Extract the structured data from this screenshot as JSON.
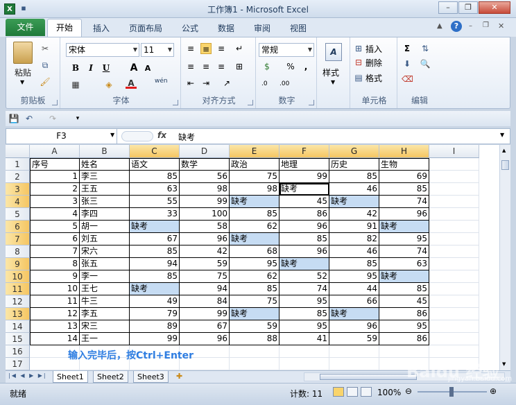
{
  "window": {
    "title": "工作簿1 - Microsoft Excel",
    "app_icon": "X"
  },
  "tabs": {
    "file": "文件",
    "home": "开始",
    "insert": "插入",
    "layout": "页面布局",
    "formula": "公式",
    "data": "数据",
    "review": "审阅",
    "view": "视图"
  },
  "ribbon": {
    "clipboard": {
      "label": "剪贴板",
      "paste": "粘贴"
    },
    "font": {
      "label": "字体",
      "name": "宋体",
      "size": "11",
      "bold": "B",
      "italic": "I",
      "underline": "U",
      "grow": "A",
      "shrink": "A",
      "border": "▦",
      "fill": "◈",
      "color": "A",
      "wen": "wén"
    },
    "alignment": {
      "label": "对齐方式"
    },
    "number": {
      "label": "数字",
      "format": "常规",
      "percent": "%",
      "comma": ","
    },
    "styles": {
      "label": "样式"
    },
    "cells": {
      "label": "单元格",
      "insert": "插入",
      "delete": "删除",
      "format": "格式"
    },
    "editing": {
      "label": "编辑"
    }
  },
  "formula_bar": {
    "name_box": "F3",
    "fx": "fx",
    "value": "缺考"
  },
  "columns": [
    "A",
    "B",
    "C",
    "D",
    "E",
    "F",
    "G",
    "H",
    "I"
  ],
  "rows": [
    [
      "序号",
      "姓名",
      "语文",
      "数学",
      "政治",
      "地理",
      "历史",
      "生物"
    ],
    [
      "1",
      "李三",
      "85",
      "56",
      "75",
      "99",
      "85",
      "69"
    ],
    [
      "2",
      "王五",
      "63",
      "98",
      "98",
      "缺考",
      "46",
      "85"
    ],
    [
      "3",
      "张三",
      "55",
      "99",
      "缺考",
      "45",
      "缺考",
      "74"
    ],
    [
      "4",
      "李四",
      "33",
      "100",
      "85",
      "86",
      "42",
      "96"
    ],
    [
      "5",
      "胡一",
      "缺考",
      "58",
      "62",
      "96",
      "91",
      "缺考"
    ],
    [
      "6",
      "刘五",
      "67",
      "96",
      "缺考",
      "85",
      "82",
      "95"
    ],
    [
      "7",
      "宋六",
      "85",
      "42",
      "68",
      "96",
      "46",
      "74"
    ],
    [
      "8",
      "张五",
      "94",
      "59",
      "95",
      "缺考",
      "85",
      "63"
    ],
    [
      "9",
      "李一",
      "85",
      "75",
      "62",
      "52",
      "95",
      "缺考"
    ],
    [
      "10",
      "王七",
      "缺考",
      "94",
      "85",
      "74",
      "44",
      "85"
    ],
    [
      "11",
      "牛三",
      "49",
      "84",
      "75",
      "95",
      "66",
      "45"
    ],
    [
      "12",
      "李五",
      "79",
      "99",
      "缺考",
      "85",
      "缺考",
      "86"
    ],
    [
      "13",
      "宋三",
      "89",
      "67",
      "59",
      "95",
      "96",
      "95"
    ],
    [
      "14",
      "王一",
      "99",
      "96",
      "88",
      "41",
      "59",
      "86"
    ]
  ],
  "row_numbers": [
    "1",
    "2",
    "3",
    "4",
    "5",
    "6",
    "7",
    "8",
    "9",
    "10",
    "11",
    "12",
    "13",
    "14",
    "15",
    "16",
    "17"
  ],
  "annotation": "输入完毕后，按Ctrl+Enter",
  "sheets": [
    "Sheet1",
    "Sheet2",
    "Sheet3"
  ],
  "status": {
    "mode": "就绪",
    "count": "计数: 11",
    "zoom": "100%"
  },
  "watermark": "Baidu 经验",
  "watermark_sub": "jingyan.baidu.com"
}
